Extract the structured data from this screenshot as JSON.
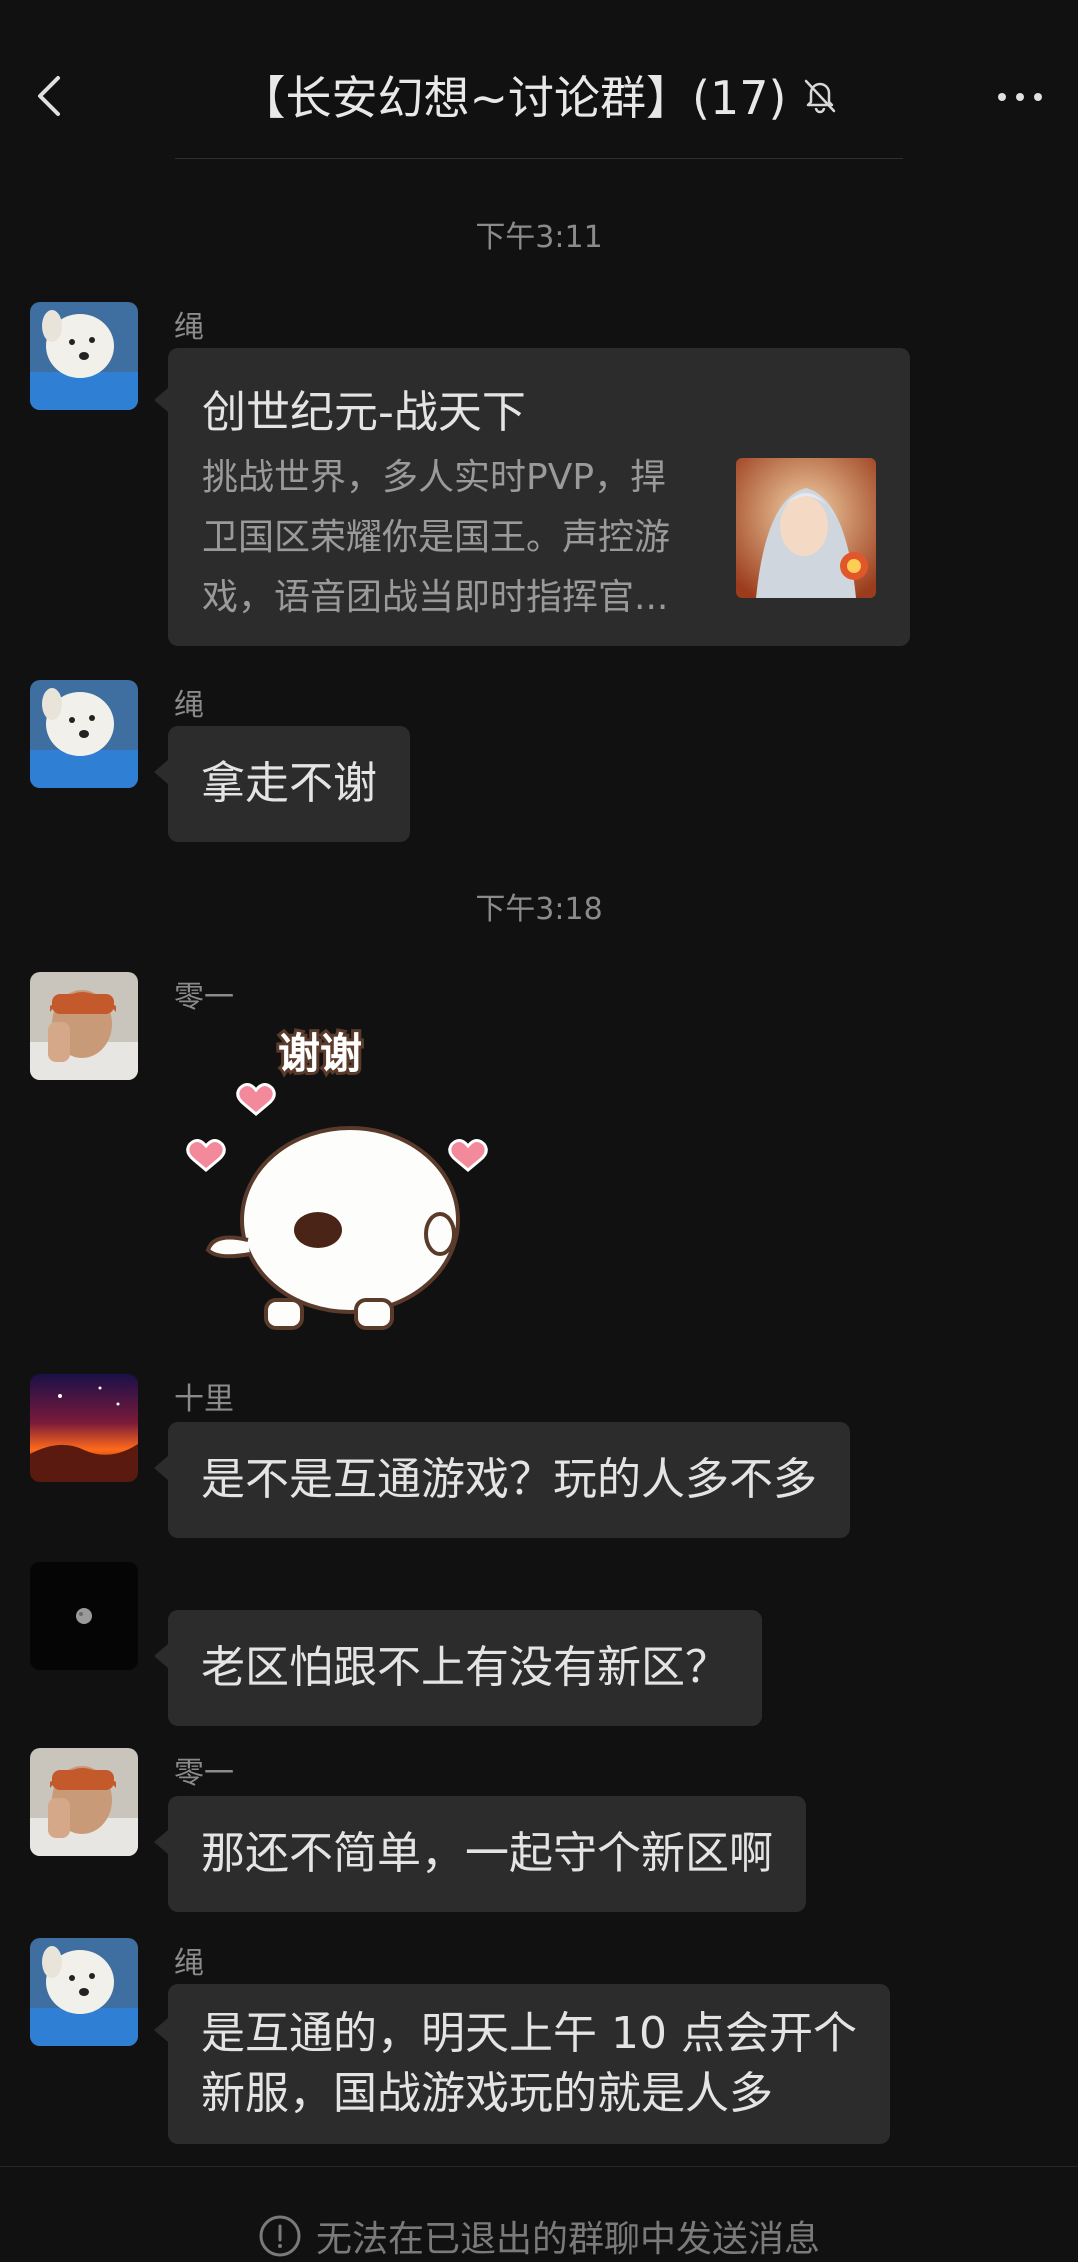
{
  "header": {
    "title": "【长安幻想~讨论群】(17)",
    "back_icon": "chevron-left-icon",
    "mute_icon": "bell-off-icon",
    "more_icon": "more-horizontal-icon"
  },
  "messages": {
    "time1": "下午3:11",
    "time2": "下午3:18",
    "m1_sender": "绳",
    "m1_card": {
      "title": "创世纪元-战天下",
      "desc_lines": [
        "挑战世界，多人实时PVP，捍",
        "卫国区荣耀你是国王。声控游",
        "戏，语音团战当即时指挥官..."
      ],
      "thumb": "game-character-image"
    },
    "m2_sender": "绳",
    "m2_text": "拿走不谢",
    "m3_sender": "零一",
    "m3_sticker_text": "谢谢",
    "m4_sender": "十里",
    "m4_text": "是不是互通游戏？玩的人多不多",
    "m5_text": "老区怕跟不上有没有新区？",
    "m6_sender": "零一",
    "m6_text": "那还不简单，一起守个新区啊",
    "m7_sender": "绳",
    "m7_lines": [
      "是互通的，明天上午 10 点会开个",
      "新服，国战游戏玩的就是人多"
    ]
  },
  "footer": {
    "notice": "无法在已退出的群聊中发送消息",
    "info_icon": "info-icon"
  },
  "colors": {
    "background": "#111111",
    "bubble": "#2c2c2c",
    "text": "#e4e4e4",
    "muted": "#8b8b8b"
  }
}
